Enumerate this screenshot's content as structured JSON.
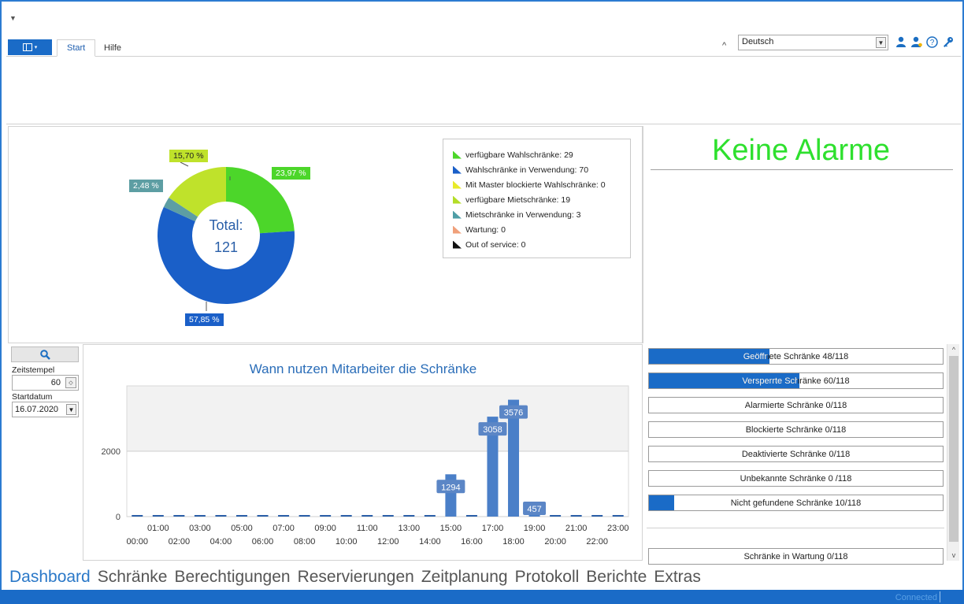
{
  "ribbon": {
    "tabs": [
      {
        "label": "Start",
        "active": true
      },
      {
        "label": "Hilfe",
        "active": false
      }
    ],
    "language": "Deutsch"
  },
  "pie": {
    "center_label": "Total:",
    "total": "121",
    "labels": {
      "green": "23,97 %",
      "blue": "57,85 %",
      "teal": "2,48 %",
      "lime": "15,70 %"
    },
    "legend": [
      {
        "label": "verfügbare Wahlschränke: 29",
        "color": "#4cd62a"
      },
      {
        "label": "Wahlschränke in Verwendung: 70",
        "color": "#1a5fc8"
      },
      {
        "label": "Mit Master blockierte Wahlschränke: 0",
        "color": "#e8ea2a"
      },
      {
        "label": "verfügbare Mietschränke: 19",
        "color": "#b4dd28"
      },
      {
        "label": "Mietschränke in Verwendung: 3",
        "color": "#4f9ea6"
      },
      {
        "label": "Wartung: 0",
        "color": "#f0a07a"
      },
      {
        "label": "Out of service: 0",
        "color": "#111111"
      }
    ]
  },
  "alarm": {
    "title": "Keine Alarme"
  },
  "filter": {
    "zeitstempel_label": "Zeitstempel",
    "zeitstempel_value": "60",
    "startdatum_label": "Startdatum",
    "startdatum_value": "16.07.2020"
  },
  "chart_data": {
    "type": "bar",
    "title": "Wann nutzen Mitarbeiter die Schränke",
    "categories": [
      "00:00",
      "01:00",
      "02:00",
      "03:00",
      "04:00",
      "05:00",
      "06:00",
      "07:00",
      "08:00",
      "09:00",
      "10:00",
      "11:00",
      "12:00",
      "13:00",
      "14:00",
      "15:00",
      "16:00",
      "17:00",
      "18:00",
      "19:00",
      "20:00",
      "21:00",
      "22:00",
      "23:00"
    ],
    "values": [
      0,
      0,
      0,
      0,
      0,
      0,
      0,
      0,
      0,
      0,
      0,
      0,
      0,
      0,
      0,
      1294,
      0,
      3058,
      3576,
      457,
      0,
      0,
      0,
      0
    ],
    "data_labels": {
      "15": "1294",
      "17": "3058",
      "18": "3576",
      "19": "457"
    },
    "yticks": [
      0,
      2000
    ],
    "ylim": [
      0,
      4000
    ],
    "color": "#4a7fc8"
  },
  "status": {
    "items": [
      {
        "label": "Geöffnete Schränke 48/118",
        "fraction": 0.407
      },
      {
        "label": "Versperrte Schränke 60/118",
        "fraction": 0.508
      },
      {
        "label": "Alarmierte Schränke 0/118",
        "fraction": 0
      },
      {
        "label": "Blockierte Schränke 0/118",
        "fraction": 0
      },
      {
        "label": "Deaktivierte Schränke 0/118",
        "fraction": 0
      },
      {
        "label": "Unbekannte Schränke 0 /118",
        "fraction": 0
      },
      {
        "label": "Nicht gefundene Schränke 10/118",
        "fraction": 0.085
      }
    ],
    "maintenance": {
      "label": "Schränke in Wartung 0/118",
      "fraction": 0
    }
  },
  "nav": [
    "Dashboard",
    "Schränke",
    "Berechtigungen",
    "Reservierungen",
    "Zeitplanung",
    "Protokoll",
    "Berichte",
    "Extras"
  ],
  "statusbar": {
    "connection": "Connected"
  }
}
